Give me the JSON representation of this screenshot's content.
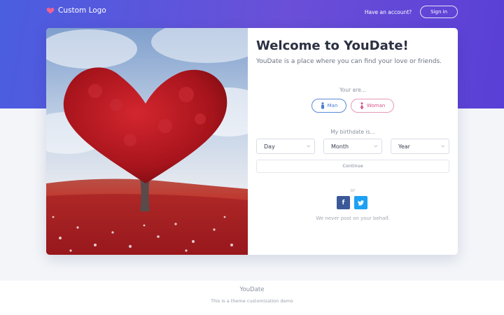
{
  "navbar": {
    "logo_text": "Custom Logo",
    "logo_icon": "heart-icon",
    "have_account": "Have an account?",
    "signin_label": "Sign in"
  },
  "card": {
    "image": "heart-shaped-tree-photo",
    "title": "Welcome to YouDate!",
    "subtitle": "YouDate is a place where you can find your love or friends.",
    "gender": {
      "label": "Your are...",
      "man_label": "Man",
      "woman_label": "Woman"
    },
    "birthdate": {
      "label": "My birthdate is...",
      "day": "Day",
      "month": "Month",
      "year": "Year"
    },
    "continue_label": "Continue",
    "or_label": "or",
    "social": {
      "facebook": "f",
      "twitter_icon": "twitter-icon"
    },
    "never_post": "We never post on your behalf."
  },
  "footer": {
    "title": "YouDate",
    "subtitle": "This is a theme customization demo"
  },
  "colors": {
    "hero_gradient_start": "#4a5ee0",
    "hero_gradient_end": "#5a3fd6",
    "man_accent": "#4a7ed6",
    "woman_accent": "#d8538a",
    "facebook": "#3b5998",
    "twitter": "#1da1f2",
    "logo_heart": "#f06292"
  }
}
